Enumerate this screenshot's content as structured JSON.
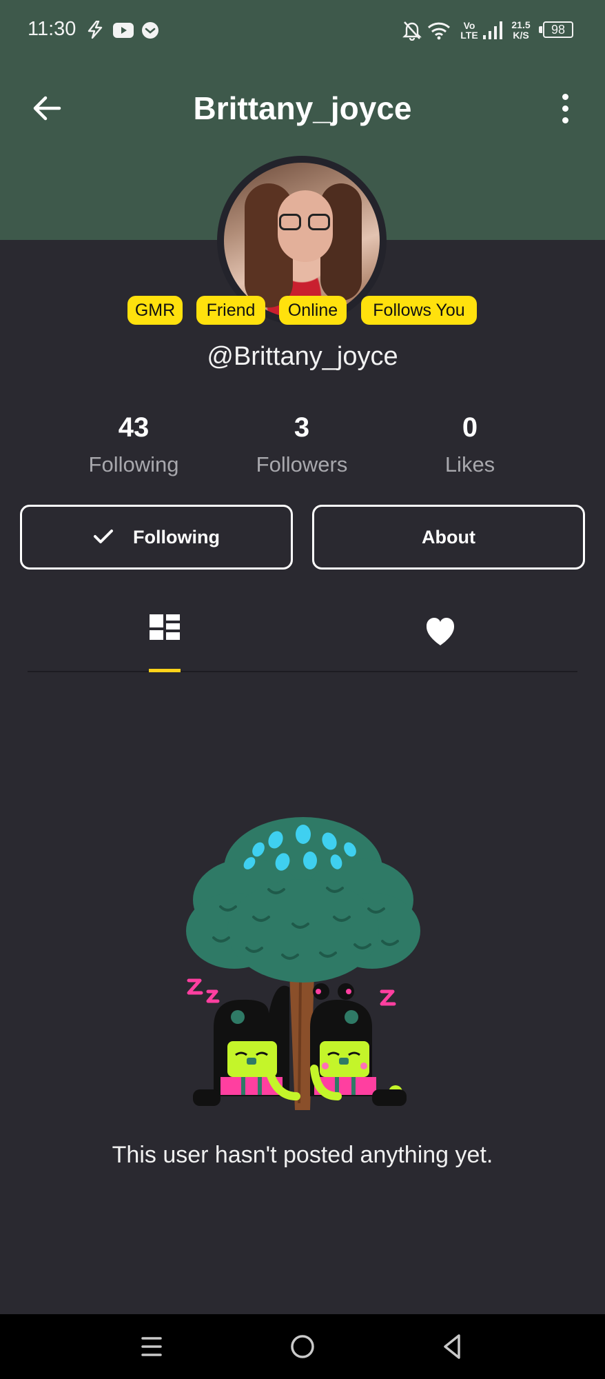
{
  "status_bar": {
    "time": "11:30",
    "network_type_top": "Vo",
    "network_type_bottom": "LTE",
    "speed_value": "21.5",
    "speed_unit": "K/S",
    "battery": "98",
    "icons": [
      "flash-icon",
      "youtube-icon",
      "message-icon",
      "mute-bell-icon",
      "wifi-icon",
      "signal-icon",
      "battery-icon"
    ]
  },
  "header": {
    "title": "Brittany_joyce",
    "back_icon": "arrow-left-icon",
    "menu_icon": "more-vertical-icon"
  },
  "profile": {
    "badges": [
      "GMR",
      "Friend",
      "Online",
      "Follows You"
    ],
    "handle": "@Brittany_joyce"
  },
  "stats": [
    {
      "value": "43",
      "label": "Following"
    },
    {
      "value": "3",
      "label": "Followers"
    },
    {
      "value": "0",
      "label": "Likes"
    }
  ],
  "actions": {
    "following_label": "Following",
    "about_label": "About"
  },
  "tabs": [
    {
      "icon": "grid-icon",
      "active": true
    },
    {
      "icon": "heart-icon",
      "active": false
    }
  ],
  "empty_state": {
    "message": "This user hasn't posted anything yet."
  },
  "colors": {
    "header_bg": "#3e594b",
    "page_bg": "#2a2930",
    "badge_bg": "#ffe10d",
    "tab_indicator": "#ffd21a"
  }
}
